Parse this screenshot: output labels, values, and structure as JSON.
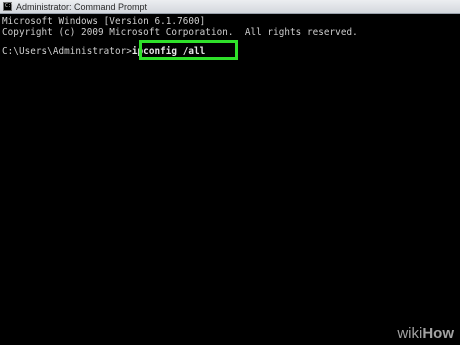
{
  "window": {
    "title": "Administrator: Command Prompt",
    "icon": "cmd-icon"
  },
  "console": {
    "lines": [
      "Microsoft Windows [Version 6.1.7600]",
      "Copyright (c) 2009 Microsoft Corporation.  All rights reserved."
    ],
    "prompt": "C:\\Users\\Administrator>",
    "command": "ipconfig /all",
    "highlight_color": "#2fe02a"
  },
  "watermark": {
    "wiki": "wiki",
    "how": "How"
  }
}
